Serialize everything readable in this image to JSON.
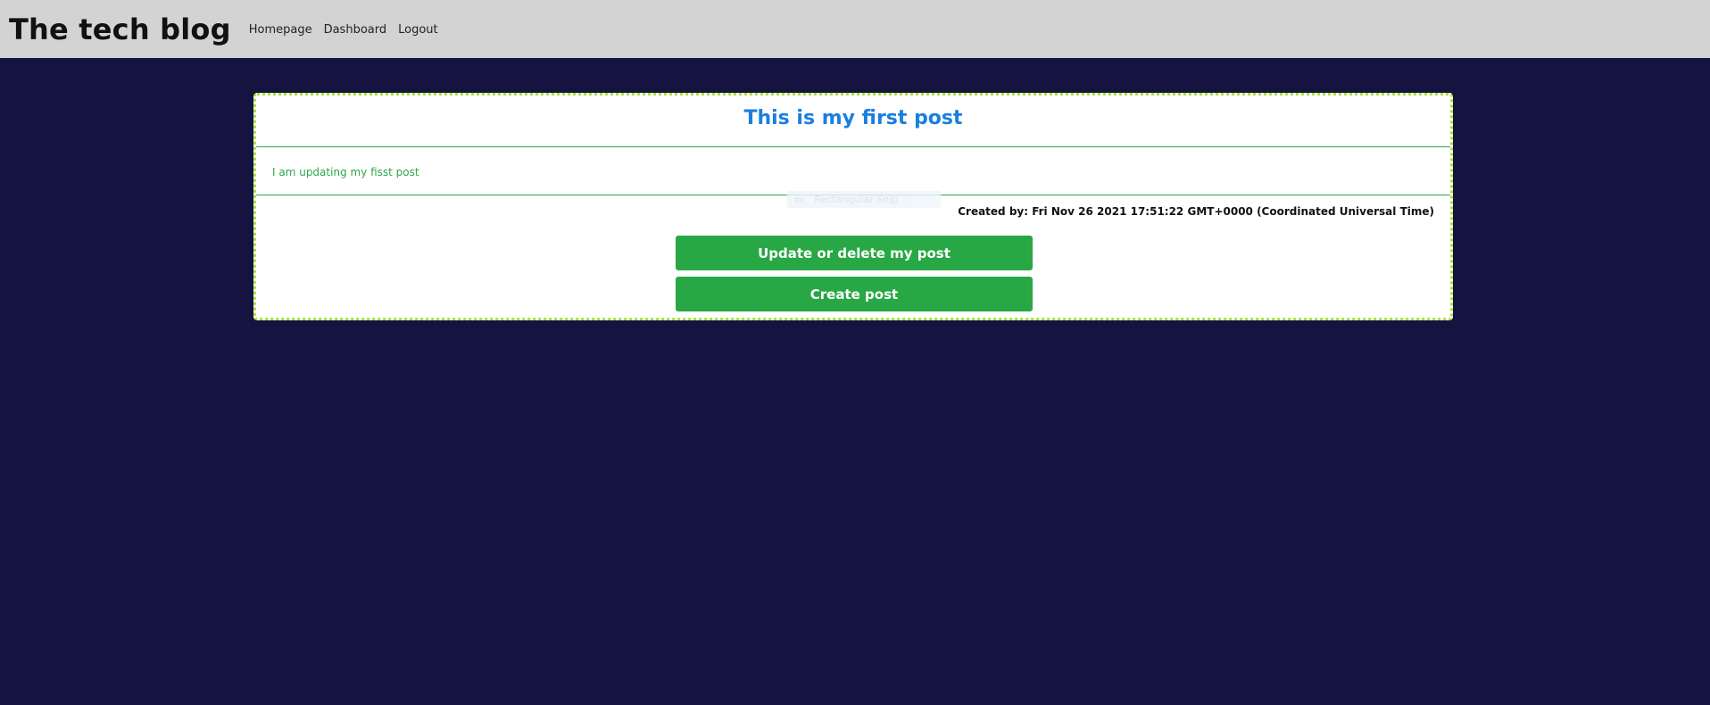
{
  "header": {
    "title": "The tech blog",
    "nav": [
      {
        "label": "Homepage"
      },
      {
        "label": "Dashboard"
      },
      {
        "label": "Logout"
      }
    ]
  },
  "post": {
    "title": "This is my first post",
    "body": "I am updating my fisst post",
    "created_by": "Created by: Fri Nov 26 2021 17:51:22 GMT+0000 (Coordinated Universal Time)",
    "update_button": "Update or delete my post",
    "create_button": "Create post"
  },
  "overlay": {
    "ghost_tooltip_text": "Rectangular Snip"
  },
  "colors": {
    "page_bg": "#151340",
    "header_bg": "#d3d3d3",
    "title_blue": "#1a7fe0",
    "accent_green": "#28a745",
    "card_border": "#a6e22e"
  }
}
